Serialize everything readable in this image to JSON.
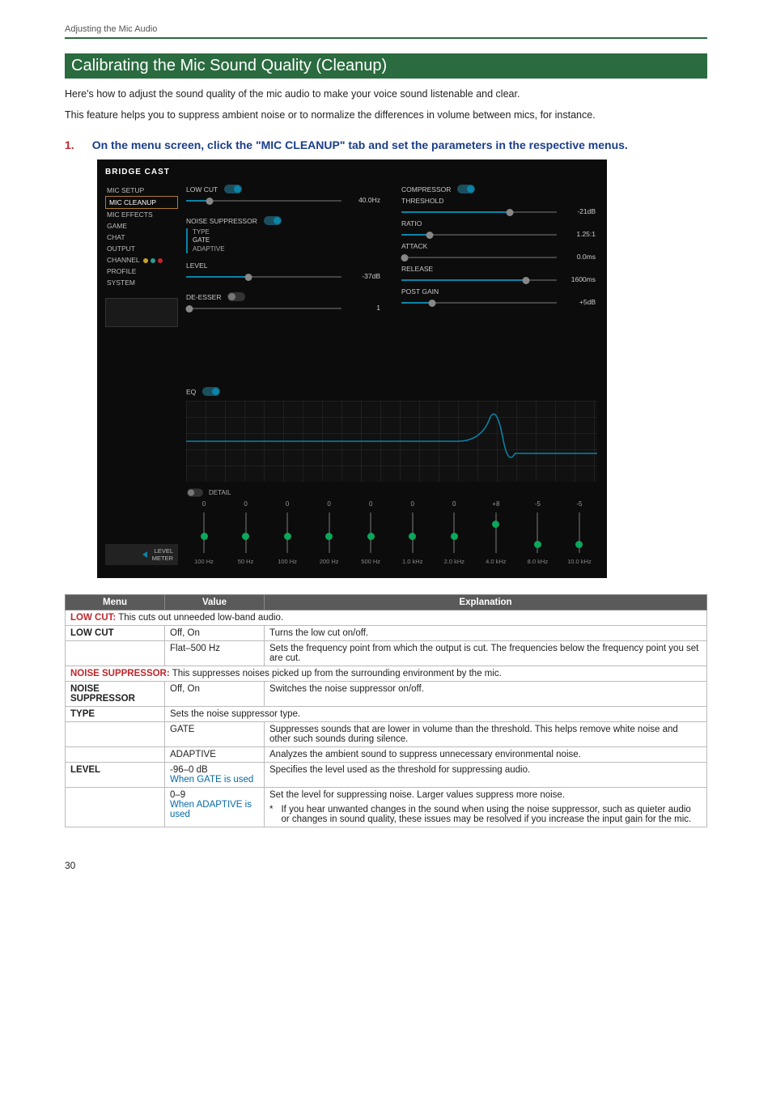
{
  "breadcrumb": "Adjusting the Mic Audio",
  "section_title": "Calibrating the Mic Sound Quality (Cleanup)",
  "intro1": "Here's how to adjust the sound quality of the mic audio to make your voice sound listenable and clear.",
  "intro2": "This feature helps you to suppress ambient noise or to normalize the differences in volume between mics, for instance.",
  "step_num": "1.",
  "step_text": "On the menu screen, click the \"MIC CLEANUP\" tab and   set the parameters in the respective menus.",
  "app": {
    "logo": "BRIDGE CAST",
    "sidebar": {
      "items": [
        "MIC SETUP",
        "MIC CLEANUP",
        "MIC EFFECTS",
        "GAME",
        "CHAT",
        "OUTPUT",
        "CHANNEL",
        "PROFILE",
        "SYSTEM"
      ],
      "selected_index": 1,
      "level_meter": "LEVEL\nMETER"
    },
    "left": {
      "lowcut_label": "LOW CUT",
      "lowcut_val": "40.0Hz",
      "ns_label": "NOISE SUPPRESSOR",
      "type_label": "TYPE",
      "type_gate": "GATE",
      "type_adaptive": "ADAPTIVE",
      "level_label": "LEVEL",
      "level_val": "-37dB",
      "deesser_label": "DE-ESSER",
      "deesser_val": "1"
    },
    "right": {
      "comp_label": "COMPRESSOR",
      "threshold_label": "THRESHOLD",
      "threshold_val": "-21dB",
      "ratio_label": "RATIO",
      "ratio_val": "1.25:1",
      "attack_label": "ATTACK",
      "attack_val": "0.0ms",
      "release_label": "RELEASE",
      "release_val": "1600ms",
      "postgain_label": "POST GAIN",
      "postgain_val": "+5dB"
    },
    "eq": {
      "label": "EQ",
      "detail_label": "DETAIL",
      "bands": [
        {
          "val": "0",
          "freq": "100 Hz",
          "pos": 50
        },
        {
          "val": "0",
          "freq": "50 Hz",
          "pos": 50
        },
        {
          "val": "0",
          "freq": "100 Hz",
          "pos": 50
        },
        {
          "val": "0",
          "freq": "200 Hz",
          "pos": 50
        },
        {
          "val": "0",
          "freq": "500 Hz",
          "pos": 50
        },
        {
          "val": "0",
          "freq": "1.0 kHz",
          "pos": 50
        },
        {
          "val": "0",
          "freq": "2.0 kHz",
          "pos": 50
        },
        {
          "val": "+8",
          "freq": "4.0 kHz",
          "pos": 20
        },
        {
          "val": "-5",
          "freq": "8.0 kHz",
          "pos": 70
        },
        {
          "val": "-5",
          "freq": "10.0 kHz",
          "pos": 70
        }
      ]
    }
  },
  "table": {
    "headers": [
      "Menu",
      "Value",
      "Explanation"
    ],
    "sections": [
      {
        "label": "LOW CUT:",
        "desc": " This cuts out unneeded low-band audio.",
        "rows": [
          {
            "menu": "LOW CUT",
            "value": "Off, On",
            "expl": "Turns the low cut on/off."
          },
          {
            "menu": "",
            "value": "Flat–500 Hz",
            "expl": "Sets the frequency point from which the output is cut. The frequencies below the frequency point you set are cut."
          }
        ]
      },
      {
        "label": "NOISE SUPPRESSOR:",
        "desc": " This suppresses noises picked up from the surrounding environment by the mic.",
        "rows": [
          {
            "menu": "NOISE SUPPRESSOR",
            "value": "Off, On",
            "expl": "Switches the noise suppressor on/off."
          },
          {
            "menu": "TYPE",
            "value_span": "Sets the noise suppressor type."
          },
          {
            "menu": "",
            "value": "GATE",
            "expl": "Suppresses sounds that are lower in volume than the threshold. This helps remove white noise and other such sounds during silence."
          },
          {
            "menu": "",
            "value": "ADAPTIVE",
            "expl": "Analyzes the ambient sound to suppress unnecessary environmental noise."
          },
          {
            "menu": "LEVEL",
            "value": "-96–0 dB",
            "note": "When GATE is used",
            "expl": "Specifies the level used as the threshold for suppressing audio."
          },
          {
            "menu": "",
            "value": "0–9",
            "note": "When ADAPTIVE is used",
            "expl": "Set the level for suppressing noise. Larger values suppress more noise.",
            "footnote": "If you hear unwanted changes in the sound when using the noise suppressor, such as quieter audio or changes in sound quality, these issues may be resolved if you increase the input gain for the mic."
          }
        ]
      }
    ]
  },
  "page_num": "30"
}
